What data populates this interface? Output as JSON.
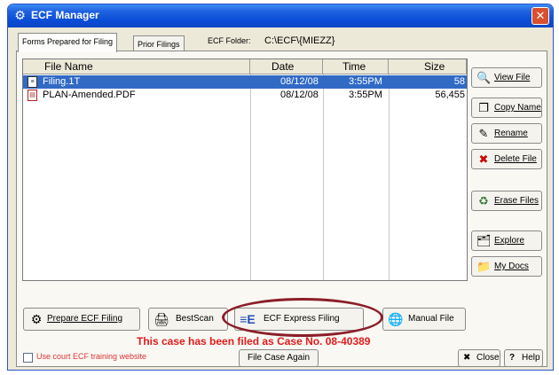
{
  "window": {
    "title": "ECF Manager",
    "close_glyph": "✕"
  },
  "tabs": [
    {
      "label": "Forms Prepared for Filing"
    },
    {
      "label": "Prior Filings"
    }
  ],
  "folder": {
    "label": "ECF Folder:",
    "value": "C:\\ECF\\{MIEZZ}"
  },
  "list": {
    "columns": [
      "File Name",
      "Date",
      "Time",
      "Size"
    ],
    "rows": [
      {
        "name": "Filing.1T",
        "date": "08/12/08",
        "time": "3:55PM",
        "size": "58",
        "selected": true,
        "icon": "text-file-icon"
      },
      {
        "name": "PLAN-Amended.PDF",
        "date": "08/12/08",
        "time": "3:55PM",
        "size": "56,455",
        "selected": false,
        "icon": "pdf-file-icon"
      }
    ]
  },
  "side_buttons": {
    "view_file": "View File",
    "copy_name": "Copy Name",
    "rename": "Rename",
    "delete_file": "Delete File",
    "erase_files": "Erase Files",
    "explore": "Explore",
    "my_docs": "My Docs"
  },
  "bottom_buttons": {
    "prepare": "Prepare ECF Filing",
    "bestscan": "BestScan",
    "express": "ECF Express Filing",
    "manual": "Manual File"
  },
  "status_message": "This case has been filed as Case No. 08-40389",
  "footer": {
    "training_label": "Use court ECF training website",
    "file_again": "File Case Again",
    "close": "Close",
    "help": "Help"
  },
  "colors": {
    "selection": "#316ac5",
    "status_text": "#e01b1b",
    "title_bar": "#0a4cd6",
    "highlight_ellipse": "#8b1e28"
  }
}
